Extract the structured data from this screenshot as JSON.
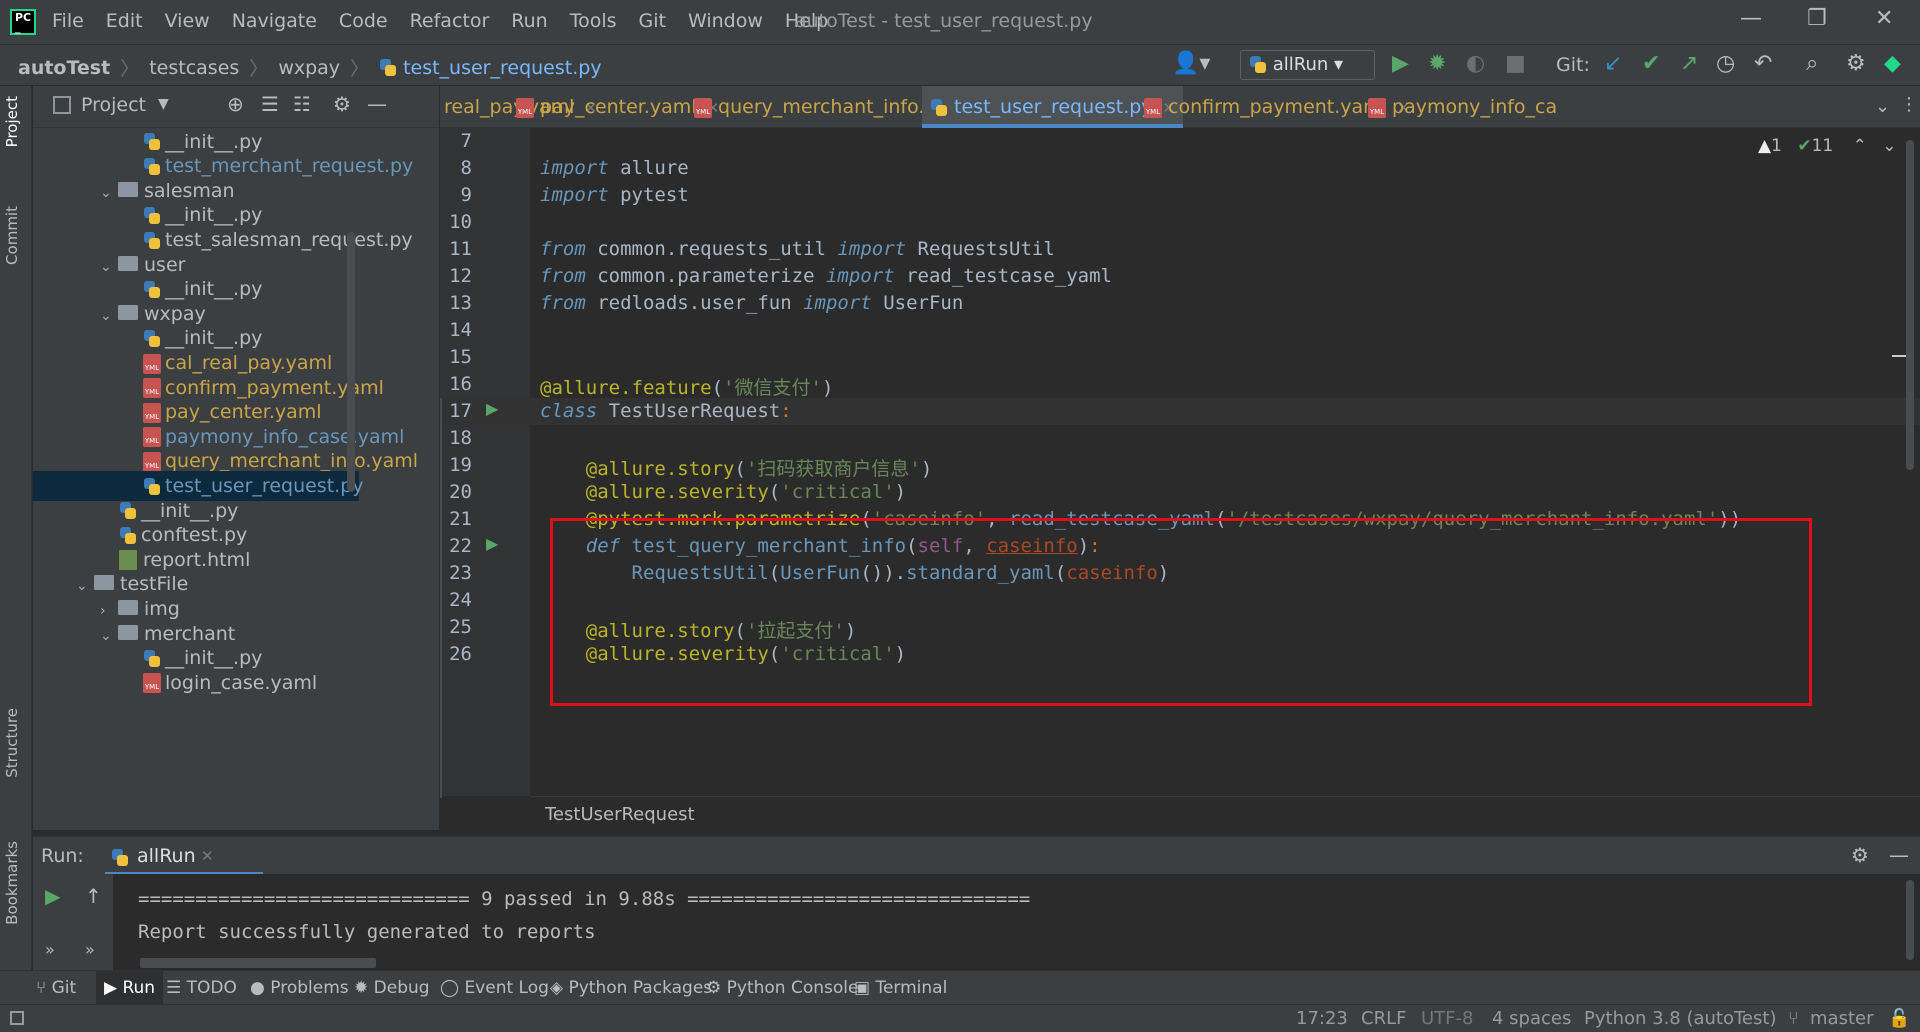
{
  "window": {
    "title": "autoTest - test_user_request.py"
  },
  "menu": [
    "File",
    "Edit",
    "View",
    "Navigate",
    "Code",
    "Refactor",
    "Run",
    "Tools",
    "Git",
    "Window",
    "Help"
  ],
  "breadcrumb": [
    "autoTest",
    "testcases",
    "wxpay",
    "test_user_request.py"
  ],
  "toolbar": {
    "run_config": "allRun",
    "git_label": "Git:"
  },
  "left_strip": {
    "project": "Project",
    "commit": "Commit",
    "structure": "Structure",
    "bookmarks": "Bookmarks"
  },
  "project": {
    "title": "Project",
    "tree": [
      {
        "label": "merchant",
        "type": "folder",
        "open": true,
        "indent": 0
      },
      {
        "label": "__init__.py",
        "type": "py",
        "indent": 1
      },
      {
        "label": "test_merchant_request.py",
        "type": "py",
        "indent": 1,
        "color": "#6897bb"
      },
      {
        "label": "salesman",
        "type": "folder",
        "open": true,
        "indent": 0
      },
      {
        "label": "__init__.py",
        "type": "py",
        "indent": 1
      },
      {
        "label": "test_salesman_request.py",
        "type": "py",
        "indent": 1
      },
      {
        "label": "user",
        "type": "folder",
        "open": true,
        "indent": 0
      },
      {
        "label": "__init__.py",
        "type": "py",
        "indent": 1
      },
      {
        "label": "wxpay",
        "type": "folder",
        "open": true,
        "indent": 0
      },
      {
        "label": "__init__.py",
        "type": "py",
        "indent": 1
      },
      {
        "label": "cal_real_pay.yaml",
        "type": "yml",
        "indent": 1,
        "color": "#c9a548"
      },
      {
        "label": "confirm_payment.yaml",
        "type": "yml",
        "indent": 1,
        "color": "#c9a548"
      },
      {
        "label": "pay_center.yaml",
        "type": "yml",
        "indent": 1,
        "color": "#c9a548"
      },
      {
        "label": "paymony_info_case.yaml",
        "type": "yml",
        "indent": 1,
        "color": "#6897bb"
      },
      {
        "label": "query_merchant_info.yaml",
        "type": "yml",
        "indent": 1,
        "color": "#c9a548"
      },
      {
        "label": "test_user_request.py",
        "type": "py",
        "indent": 1,
        "color": "#6897bb",
        "selected": true
      },
      {
        "label": "__init__.py",
        "type": "py",
        "indent": 0
      },
      {
        "label": "conftest.py",
        "type": "py",
        "indent": 0
      },
      {
        "label": "report.html",
        "type": "html",
        "indent": 0
      },
      {
        "label": "testFile",
        "type": "folder",
        "open": true,
        "indent": -1
      },
      {
        "label": "img",
        "type": "folder",
        "open": false,
        "indent": 0
      },
      {
        "label": "merchant",
        "type": "folder",
        "open": true,
        "indent": 0
      },
      {
        "label": "__init__.py",
        "type": "py",
        "indent": 1
      },
      {
        "label": "login_case.yaml",
        "type": "yml",
        "indent": 1
      }
    ]
  },
  "tabs": [
    {
      "label": "real_pay.yaml",
      "type": "yml"
    },
    {
      "label": "pay_center.yaml",
      "type": "yml"
    },
    {
      "label": "query_merchant_info.yaml",
      "type": "yml"
    },
    {
      "label": "test_user_request.py",
      "type": "py",
      "active": true
    },
    {
      "label": "confirm_payment.yaml",
      "type": "yml"
    },
    {
      "label": "paymony_info_ca",
      "type": "yml"
    }
  ],
  "inspections": {
    "warnings": "1",
    "ok": "11"
  },
  "editor": {
    "current_line": 17,
    "lines": [
      {
        "n": "7",
        "html": ""
      },
      {
        "n": "8",
        "html": "<span class='kw2 kw'>import</span> allure"
      },
      {
        "n": "9",
        "html": "<span class='kw2 kw'>import</span> pytest"
      },
      {
        "n": "10",
        "html": ""
      },
      {
        "n": "11",
        "html": "<span class='kw2 kw'>from</span> common.requests_util <span class='kw2 kw'>import</span> RequestsUtil"
      },
      {
        "n": "12",
        "html": "<span class='kw2 kw'>from</span> common.parameterize <span class='kw2 kw'>import</span> read_testcase_yaml"
      },
      {
        "n": "13",
        "html": "<span class='kw2 kw'>from</span> redloads.user_fun <span class='kw2 kw'>import</span> UserFun"
      },
      {
        "n": "14",
        "html": ""
      },
      {
        "n": "15",
        "html": ""
      },
      {
        "n": "16",
        "html": "<span class='dec'>@allure.feature</span>(<span class='str'>'微信支付'</span>)"
      },
      {
        "n": "17",
        "html": "<span class='kw2 kw'>class</span> <span class='cls'>TestUserRequest</span><span style='color:#cc7832'>:</span>"
      },
      {
        "n": "18",
        "html": ""
      },
      {
        "n": "19",
        "html": "    <span class='dec'>@allure.story</span>(<span class='str'>'扫码获取商户信息'</span>)"
      },
      {
        "n": "20",
        "html": "    <span class='dec'>@allure.severity</span>(<span class='str'>'critical'</span>)"
      },
      {
        "n": "21",
        "html": "    <span class='dec'>@pytest.mark.parametrize</span>(<span class='str'>'caseinfo'</span>, <span class='kw2'>read_testcase_yaml</span>(<span class='str'>'/testcases/wxpay/query_merchant_info.yaml'</span>))"
      },
      {
        "n": "22",
        "html": "    <span class='kw2 kw'>def</span> <span class='kw2'>test_query_merchant_info</span>(<span class='slf'>self</span>, <span class='prm'>caseinfo</span>)<span style='color:#cc7832'>:</span>"
      },
      {
        "n": "23",
        "html": "        <span class='kw2'>RequestsUtil</span>(<span class='kw2'>UserFun</span>()).<span class='kw2'>standard_yaml</span>(<span class='prm' style='text-decoration:none'>caseinfo</span>)"
      },
      {
        "n": "24",
        "html": ""
      },
      {
        "n": "25",
        "html": "    <span class='dec'>@allure.story</span>(<span class='str'>'拉起支付'</span>)"
      },
      {
        "n": "26",
        "html": "    <span class='dec'>@allure.severity</span>(<span class='str'>'critical'</span>)"
      }
    ]
  },
  "editor_crumb": "TestUserRequest",
  "run": {
    "label": "Run:",
    "config": "allRun",
    "output": [
      "============================= 9 passed in 9.88s ==============================",
      "Report successfully generated to reports"
    ]
  },
  "toolwindows": [
    {
      "label": "Git",
      "icon": "⑂"
    },
    {
      "label": "Run",
      "icon": "▶",
      "active": true
    },
    {
      "label": "TODO",
      "icon": "☰"
    },
    {
      "label": "Problems",
      "icon": "●"
    },
    {
      "label": "Debug",
      "icon": "✹"
    },
    {
      "label": "Event Log",
      "icon": "◯"
    },
    {
      "label": "Python Packages",
      "icon": "◈"
    },
    {
      "label": "Python Console",
      "icon": "⚙"
    },
    {
      "label": "Terminal",
      "icon": "▣"
    }
  ],
  "status": {
    "position": "17:23",
    "line_sep": "CRLF",
    "encoding": "UTF-8",
    "indent": "4 spaces",
    "interpreter": "Python 3.8 (autoTest)",
    "branch": "master"
  },
  "colors": {
    "accent": "#4a88c7",
    "highlight_box": "#e0101a",
    "selection": "#0d293e"
  }
}
